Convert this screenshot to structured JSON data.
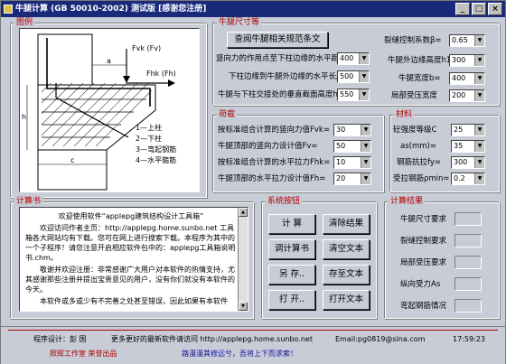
{
  "window": {
    "title": "牛腿计算 (GB 50010-2002) 测试版 [感谢您注册]",
    "min_label": "_",
    "max_label": "□",
    "close_label": "×"
  },
  "figure_group": {
    "title": "图例",
    "labels": {
      "fvk": "Fvk (Fv)",
      "fhk": "Fhk (Fh)",
      "a": "a",
      "c": "c",
      "h": "h",
      "legend1": "1—上柱",
      "legend2": "2—下柱",
      "legend3": "3—弯起钢筋",
      "legend4": "4—水平箍筋"
    }
  },
  "dims_group": {
    "title": "牛腿尺寸等",
    "view_button": "查阅牛腿相关规范条文",
    "rows": [
      {
        "label": "竖向力的作用点至下柱边缘的水平距离a=",
        "value": "400"
      },
      {
        "label": "下柱边缘到牛腿外边缘的水平长度c=",
        "value": "500"
      },
      {
        "label": "牛腿与下柱交接处的垂直截面高度h=",
        "value": "550"
      }
    ],
    "right_rows": [
      {
        "label": "裂缝控制系数β=",
        "value": "0.65"
      },
      {
        "label": "牛腿外边缘高度h1",
        "value": "300"
      },
      {
        "label": "牛腿宽度b=",
        "value": "400"
      },
      {
        "label": "局部受压宽度",
        "value": "200"
      }
    ]
  },
  "load_group": {
    "title": "荷载",
    "rows": [
      {
        "label": "按标准组合计算的竖向力值Fvk=",
        "value": "30"
      },
      {
        "label": "牛腿顶部的竖向力设计值Fv=",
        "value": "50"
      },
      {
        "label": "按标准组合计算的水平拉力Fhk=",
        "value": "10"
      },
      {
        "label": "牛腿顶部的水平拉力设计值Fh=",
        "value": "20"
      }
    ]
  },
  "material_group": {
    "title": "材料",
    "rows": [
      {
        "label": "砼强度等级C",
        "value": "25"
      },
      {
        "label": "as(mm)=",
        "value": "35"
      },
      {
        "label": "钢筋抗拉fy=",
        "value": "300"
      },
      {
        "label": "受拉钢筋ρmin=",
        "value": "0.2"
      }
    ]
  },
  "notes_group": {
    "title": "计算书",
    "heading": "欢迎使用软件“applepg建筑结构设计工具箱”",
    "paragraphs": [
      "欢迎访问作者主页：http://applepg.home.sunbo.net 工具箱各大网站均有下载。您可在网上进行搜索下载。本程序为其中的一个子程序！请您注意开启相应软件包中的：applepg工具箱说明书.chm。",
      "敬谢并欢迎注册：非常感谢广大用户对本软件的热情支持，尤其感谢那些注册并提出宝贵意见的用户，没有你们就没有本软件的今天。",
      "本软件或多或少有不完善之处甚至错误，因此如果有本软件"
    ]
  },
  "buttons_group": {
    "title": "系统按钮",
    "buttons": [
      "计 算",
      "清除结果",
      "调计算书",
      "清空文本",
      "另 存..",
      "存至文本",
      "打 开..",
      "打开文本"
    ]
  },
  "results_group": {
    "title": "计算结果",
    "rows": [
      "牛腿尺寸要求",
      "裂缝控制要求",
      "局部受压要求",
      "纵向受力As",
      "弯起钢筋情况"
    ]
  },
  "status": {
    "designer": "程序设计：彭 国",
    "more": "更多更好的最新软件请访问 http://applepg.home.sunbo.net",
    "email": "Email:pg0819@sina.com",
    "time": "17:59:23",
    "studio": "照辉工作室 荣誉出品",
    "slogan": "路漫漫其修远兮，吾将上下而求索！"
  }
}
